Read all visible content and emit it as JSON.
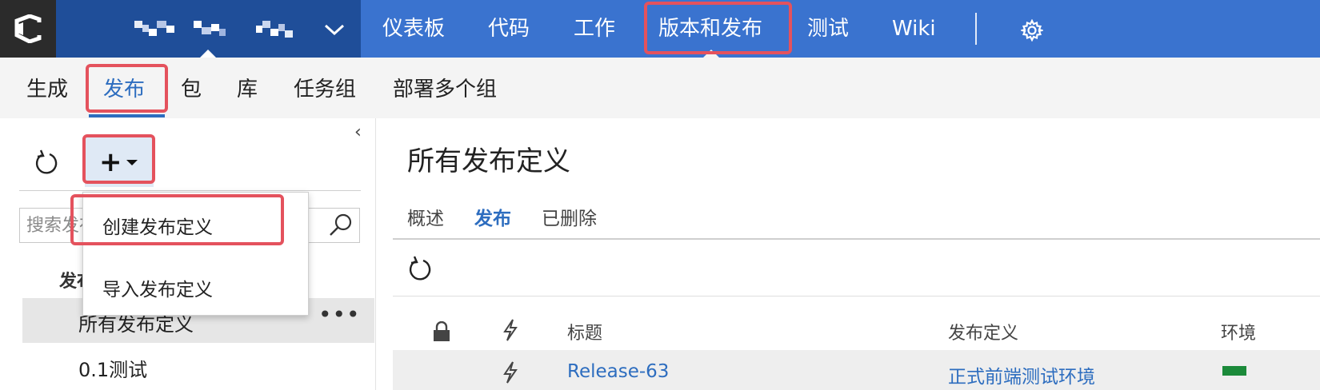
{
  "topbar": {
    "project_name": "(blurred project name)",
    "nav": [
      "仪表板",
      "代码",
      "工作",
      "版本和发布",
      "测试",
      "Wiki"
    ],
    "active_nav": "版本和发布",
    "settings_icon": "gear-icon",
    "logo_icon": "vsts-logo-icon"
  },
  "subnav": {
    "items": [
      "生成",
      "发布",
      "包",
      "库",
      "任务组",
      "部署多个组"
    ],
    "active": "发布"
  },
  "left_pane": {
    "refresh_icon": "refresh-icon",
    "add_icon": "plus-icon",
    "collapse_icon": "chevron-left-icon",
    "search_placeholder": "搜索发布定义",
    "section_label": "发布",
    "definitions": [
      {
        "label": "所有发布定义",
        "more": "•••"
      },
      {
        "label": "0.1测试"
      }
    ]
  },
  "dropdown": {
    "items": [
      "创建发布定义",
      "导入发布定义"
    ]
  },
  "main": {
    "title": "所有发布定义",
    "tabs": [
      "概述",
      "发布",
      "已删除"
    ],
    "active_tab": "发布",
    "columns": [
      "标题",
      "发布定义",
      "环境"
    ],
    "rows": [
      {
        "title": "Release-63",
        "definition": "正式前端测试环境"
      }
    ]
  },
  "colors": {
    "topbar_blue": "#3a73cf",
    "project_blue": "#1f4e99",
    "accent_blue": "#2d6dbf",
    "highlight_red": "#e4525d",
    "env_green": "#1b8a3a"
  }
}
